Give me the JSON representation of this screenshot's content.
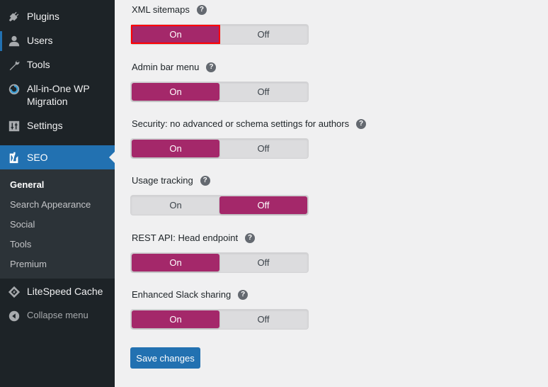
{
  "sidebar": {
    "items": [
      {
        "label": "Plugins",
        "icon": "plugin-icon"
      },
      {
        "label": "Users",
        "icon": "user-icon"
      },
      {
        "label": "Tools",
        "icon": "wrench-icon"
      },
      {
        "label": "All-in-One WP Migration",
        "label_line1": "All-in-One WP",
        "label_line2": "Migration",
        "icon": "migration-icon"
      },
      {
        "label": "Settings",
        "icon": "settings-icon"
      }
    ],
    "active": {
      "label": "SEO",
      "icon": "yoast-icon"
    },
    "submenu": [
      {
        "label": "General",
        "current": true
      },
      {
        "label": "Search Appearance"
      },
      {
        "label": "Social"
      },
      {
        "label": "Tools"
      },
      {
        "label": "Premium"
      }
    ],
    "after": [
      {
        "label": "LiteSpeed Cache",
        "icon": "litespeed-icon"
      },
      {
        "label": "Collapse menu",
        "icon": "collapse-icon"
      }
    ]
  },
  "settings": [
    {
      "label": "XML sitemaps",
      "value": "On",
      "focused": true
    },
    {
      "label": "Admin bar menu",
      "value": "On"
    },
    {
      "label": "Security: no advanced or schema settings for authors",
      "value": "On"
    },
    {
      "label": "Usage tracking",
      "value": "Off"
    },
    {
      "label": "REST API: Head endpoint",
      "value": "On"
    },
    {
      "label": "Enhanced Slack sharing",
      "value": "On"
    }
  ],
  "toggle": {
    "on_label": "On",
    "off_label": "Off"
  },
  "help_glyph": "?",
  "save_label": "Save changes",
  "colors": {
    "accent": "#a4286a",
    "primary": "#2271b1",
    "sidebar_bg": "#1d2327",
    "focus_outline": "#ff0000"
  }
}
